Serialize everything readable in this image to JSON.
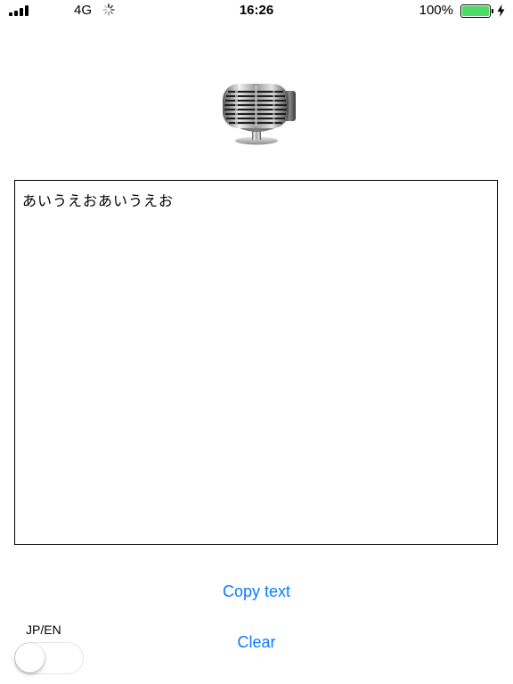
{
  "status_bar": {
    "network": "4G",
    "time": "16:26",
    "battery_percent": "100%",
    "battery_level": 1.0,
    "battery_color": "#4cd964",
    "signal_icon": "signal-bars-icon",
    "activity_icon": "activity-spinner-icon",
    "charging_icon": "charging-bolt-icon"
  },
  "header": {
    "icon": "microphone-icon"
  },
  "transcript": {
    "text": "あいうえおあいうえお"
  },
  "actions": {
    "copy_label": "Copy text",
    "clear_label": "Clear",
    "accent_color": "#0a7aff"
  },
  "language_toggle": {
    "label": "JP/EN",
    "enabled": false
  }
}
